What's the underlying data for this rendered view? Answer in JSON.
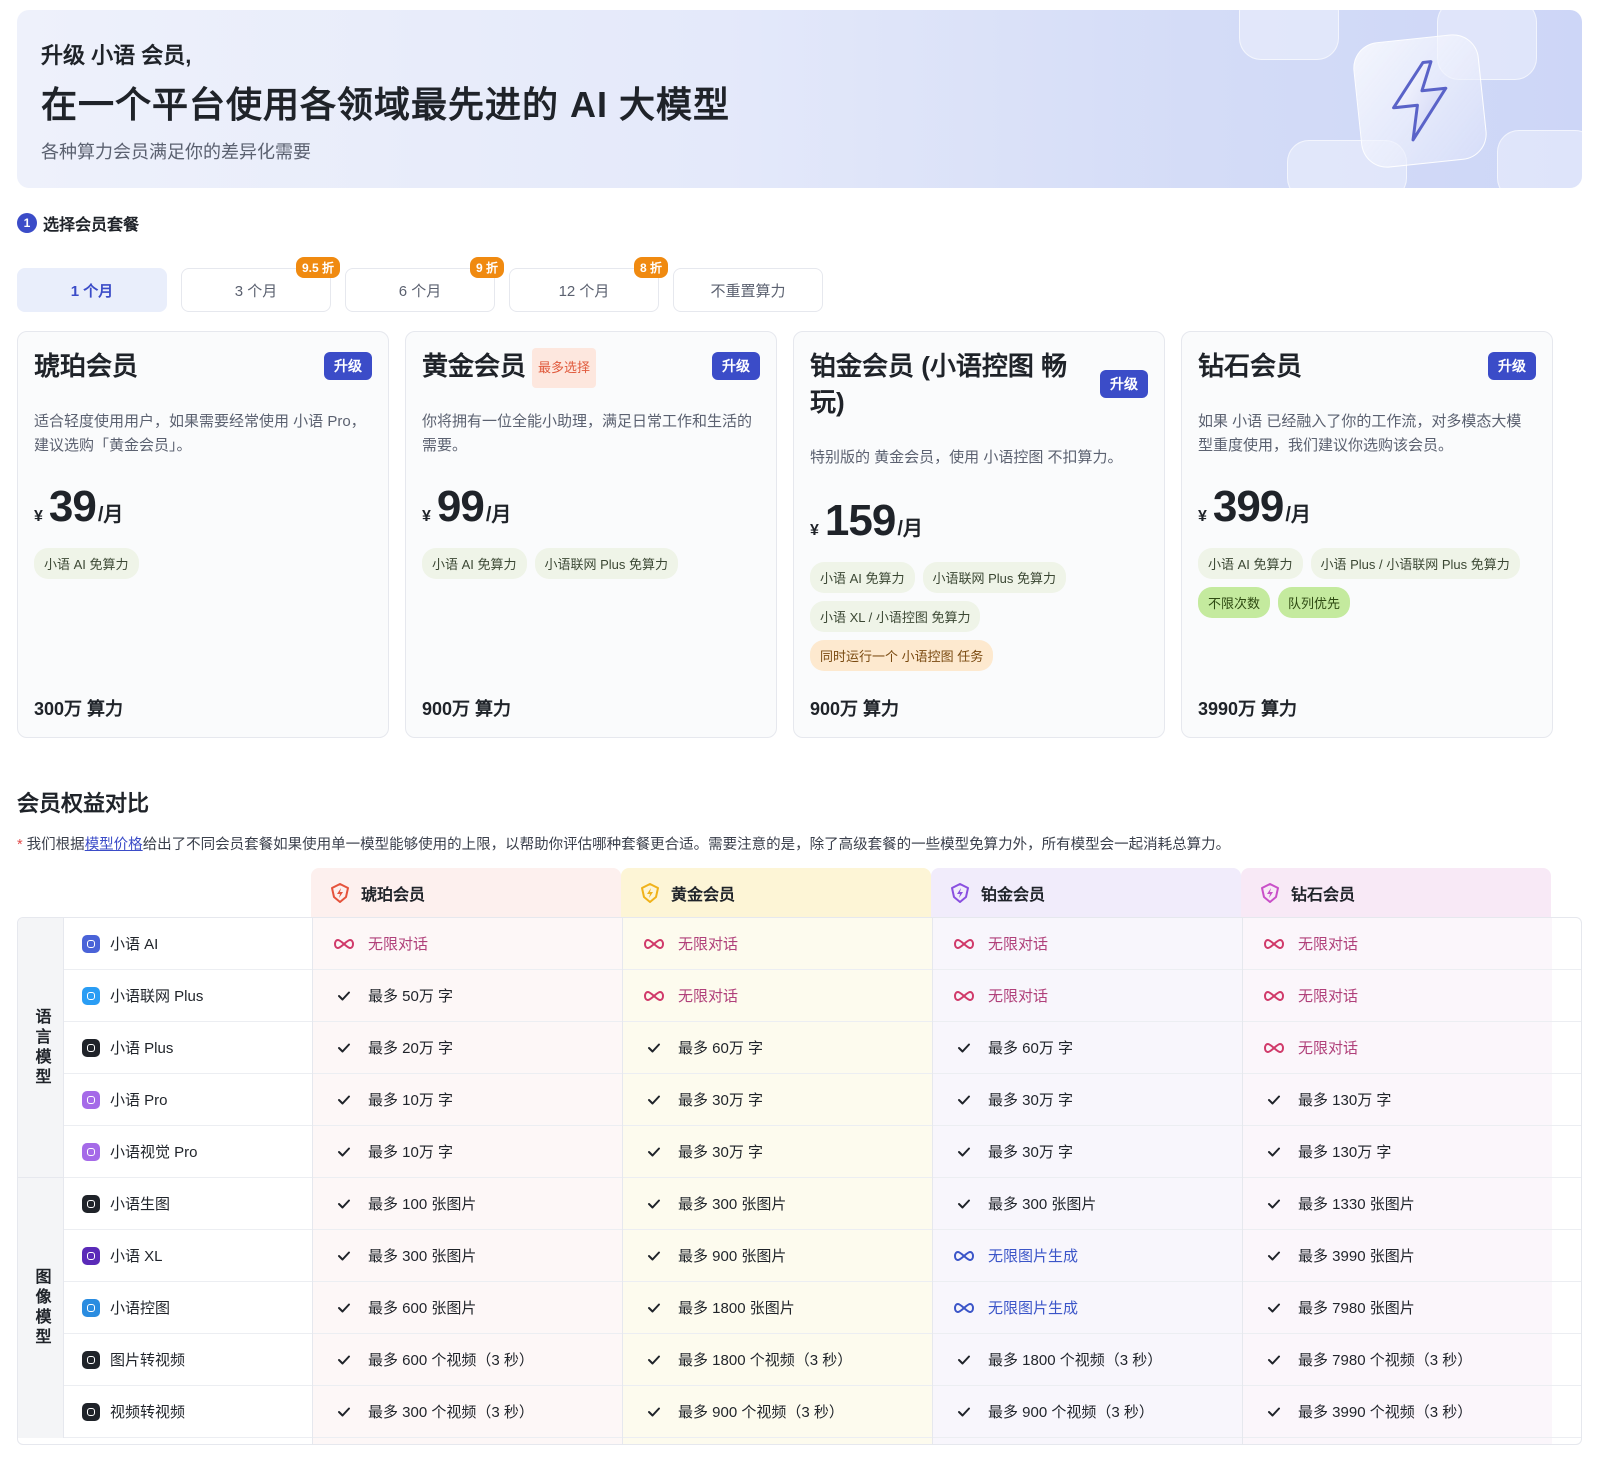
{
  "banner": {
    "small": "升级 小语 会员,",
    "big": "在一个平台使用各领域最先进的 AI 大模型",
    "sub": "各种算力会员满足你的差异化需要",
    "icon": "lightning-icon"
  },
  "step": {
    "num": "1",
    "label": "选择会员套餐"
  },
  "tabs": [
    {
      "label": "1 个月",
      "badge": ""
    },
    {
      "label": "3 个月",
      "badge": "9.5 折"
    },
    {
      "label": "6 个月",
      "badge": "9 折"
    },
    {
      "label": "12 个月",
      "badge": "8 折"
    },
    {
      "label": "不重置算力",
      "badge": ""
    }
  ],
  "cards": [
    {
      "name": "琥珀会员",
      "hot": "",
      "upgrade": "升级",
      "desc": "适合轻度使用用户，如果需要经常使用 小语 Pro，建议选购「黄金会员」。",
      "currency": "¥",
      "amount": "39",
      "per": "/月",
      "chips": [
        {
          "text": "小语 AI 免算力",
          "style": "normal"
        }
      ],
      "power": "300万 算力"
    },
    {
      "name": "黄金会员",
      "hot": "最多选择",
      "upgrade": "升级",
      "desc": "你将拥有一位全能小助理，满足日常工作和生活的需要。",
      "currency": "¥",
      "amount": "99",
      "per": "/月",
      "chips": [
        {
          "text": "小语 AI 免算力",
          "style": "normal"
        },
        {
          "text": "小语联网 Plus 免算力",
          "style": "normal"
        }
      ],
      "power": "900万 算力"
    },
    {
      "name": "铂金会员 (小语控图 畅玩)",
      "hot": "",
      "upgrade": "升级",
      "desc": "特别版的 黄金会员，使用 小语控图 不扣算力。",
      "currency": "¥",
      "amount": "159",
      "per": "/月",
      "chips": [
        {
          "text": "小语 AI 免算力",
          "style": "normal"
        },
        {
          "text": "小语联网 Plus 免算力",
          "style": "normal"
        },
        {
          "text": "小语 XL / 小语控图 免算力",
          "style": "normal"
        },
        {
          "text": "同时运行一个 小语控图 任务",
          "style": "orange"
        }
      ],
      "power": "900万 算力"
    },
    {
      "name": "钻石会员",
      "hot": "",
      "upgrade": "升级",
      "desc": "如果 小语 已经融入了你的工作流，对多模态大模型重度使用，我们建议你选购该会员。",
      "currency": "¥",
      "amount": "399",
      "per": "/月",
      "chips": [
        {
          "text": "小语 AI 免算力",
          "style": "normal"
        },
        {
          "text": "小语 Plus / 小语联网 Plus 免算力",
          "style": "normal"
        },
        {
          "text": "不限次数",
          "style": "green"
        },
        {
          "text": "队列优先",
          "style": "green"
        }
      ],
      "power": "3990万 算力"
    }
  ],
  "compare": {
    "title": "会员权益对比",
    "note_star": "*",
    "note_pre": " 我们根据",
    "note_link": "模型价格",
    "note_post": "给出了不同会员套餐如果使用单一模型能够使用的上限，以帮助你评估哪种套餐更合适。需要注意的是，除了高级套餐的一些模型免算力外，所有模型会一起消耗总算力。",
    "headers": [
      "琥珀会员",
      "黄金会员",
      "铂金会员",
      "钻石会员"
    ],
    "header_colors": [
      "#fdf0ee",
      "#fdf5d6",
      "#f1ecfb",
      "#f8e9f6"
    ],
    "header_icon_colors": [
      "#e5533c",
      "#f0b21a",
      "#8a4fe0",
      "#c94fc8"
    ],
    "col_colors": [
      "#fdf7f7",
      "#fdfbee",
      "#f8f6fc",
      "#fbf6fb"
    ],
    "groups": [
      {
        "label": "语言模型",
        "rows": 5
      },
      {
        "label": "图像模型",
        "rows": 5
      }
    ],
    "rows": [
      {
        "model": "小语 AI",
        "icon": "chat-icon",
        "icon_color": "#4a63d8",
        "cells": [
          {
            "t": "无限对话",
            "k": "inf"
          },
          {
            "t": "无限对话",
            "k": "inf"
          },
          {
            "t": "无限对话",
            "k": "inf"
          },
          {
            "t": "无限对话",
            "k": "inf"
          }
        ]
      },
      {
        "model": "小语联网 Plus",
        "icon": "chat-icon",
        "icon_color": "#2a9df4",
        "cells": [
          {
            "t": "最多 50万 字",
            "k": "check"
          },
          {
            "t": "无限对话",
            "k": "inf"
          },
          {
            "t": "无限对话",
            "k": "inf"
          },
          {
            "t": "无限对话",
            "k": "inf"
          }
        ]
      },
      {
        "model": "小语 Plus",
        "icon": "chat-icon",
        "icon_color": "#1f2329",
        "cells": [
          {
            "t": "最多 20万 字",
            "k": "check"
          },
          {
            "t": "最多 60万 字",
            "k": "check"
          },
          {
            "t": "最多 60万 字",
            "k": "check"
          },
          {
            "t": "无限对话",
            "k": "inf"
          }
        ]
      },
      {
        "model": "小语 Pro",
        "icon": "chat-icon",
        "icon_color": "#a56ae8",
        "cells": [
          {
            "t": "最多 10万 字",
            "k": "check"
          },
          {
            "t": "最多 30万 字",
            "k": "check"
          },
          {
            "t": "最多 30万 字",
            "k": "check"
          },
          {
            "t": "最多 130万 字",
            "k": "check"
          }
        ]
      },
      {
        "model": "小语视觉 Pro",
        "icon": "chat-icon",
        "icon_color": "#a56ae8",
        "cells": [
          {
            "t": "最多 10万 字",
            "k": "check"
          },
          {
            "t": "最多 30万 字",
            "k": "check"
          },
          {
            "t": "最多 30万 字",
            "k": "check"
          },
          {
            "t": "最多 130万 字",
            "k": "check"
          }
        ]
      },
      {
        "model": "小语生图",
        "icon": "image-gen-icon",
        "icon_color": "#1f2329",
        "cells": [
          {
            "t": "最多 100 张图片",
            "k": "check"
          },
          {
            "t": "最多 300 张图片",
            "k": "check"
          },
          {
            "t": "最多 300 张图片",
            "k": "check"
          },
          {
            "t": "最多 1330 张图片",
            "k": "check"
          }
        ]
      },
      {
        "model": "小语 XL",
        "icon": "xl-icon",
        "icon_color": "#5a2ab8",
        "cells": [
          {
            "t": "最多 300 张图片",
            "k": "check"
          },
          {
            "t": "最多 900 张图片",
            "k": "check"
          },
          {
            "t": "无限图片生成",
            "k": "infb"
          },
          {
            "t": "最多 3990 张图片",
            "k": "check"
          }
        ]
      },
      {
        "model": "小语控图",
        "icon": "control-icon",
        "icon_color": "#2a8ce0",
        "cells": [
          {
            "t": "最多 600 张图片",
            "k": "check"
          },
          {
            "t": "最多 1800 张图片",
            "k": "check"
          },
          {
            "t": "无限图片生成",
            "k": "infb"
          },
          {
            "t": "最多 7980 张图片",
            "k": "check"
          }
        ]
      },
      {
        "model": "图片转视频",
        "icon": "image-to-video-icon",
        "icon_color": "#1f2329",
        "cells": [
          {
            "t": "最多 600 个视频（3 秒）",
            "k": "check"
          },
          {
            "t": "最多 1800 个视频（3 秒）",
            "k": "check"
          },
          {
            "t": "最多 1800 个视频（3 秒）",
            "k": "check"
          },
          {
            "t": "最多 7980 个视频（3 秒）",
            "k": "check"
          }
        ]
      },
      {
        "model": "视频转视频",
        "icon": "video-to-video-icon",
        "icon_color": "#1f2329",
        "cells": [
          {
            "t": "最多 300 个视频（3 秒）",
            "k": "check"
          },
          {
            "t": "最多 900 个视频（3 秒）",
            "k": "check"
          },
          {
            "t": "最多 900 个视频（3 秒）",
            "k": "check"
          },
          {
            "t": "最多 3990 个视频（3 秒）",
            "k": "check"
          }
        ]
      }
    ]
  }
}
